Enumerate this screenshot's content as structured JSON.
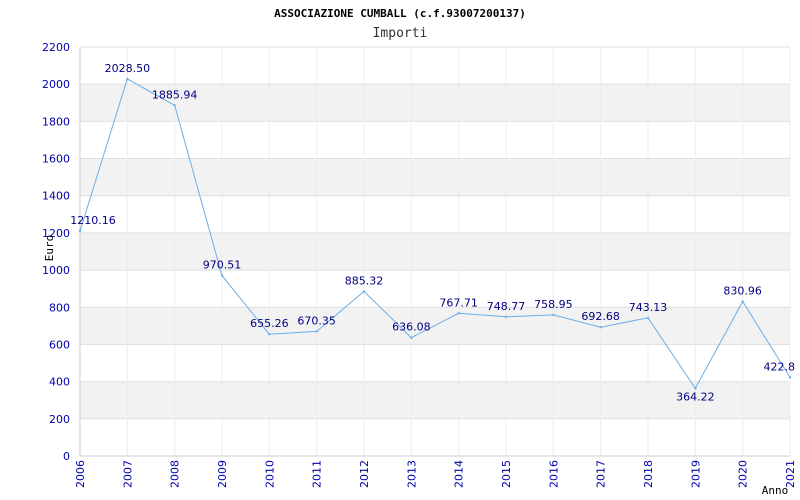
{
  "chart_data": {
    "type": "line",
    "title": "ASSOCIAZIONE CUMBALL (c.f.93007200137)",
    "subtitle": "Importi",
    "ylabel": "Euro",
    "xlabel": "Anno",
    "ylim": [
      0,
      2200
    ],
    "y_ticks": [
      0,
      200,
      400,
      600,
      800,
      1000,
      1200,
      1400,
      1600,
      1800,
      2000,
      2200
    ],
    "x": [
      "2006",
      "2007",
      "2008",
      "2009",
      "2010",
      "2011",
      "2012",
      "2013",
      "2014",
      "2015",
      "2016",
      "2017",
      "2018",
      "2019",
      "2020",
      "2021"
    ],
    "values": [
      1210.16,
      2028.5,
      1885.94,
      970.51,
      655.26,
      670.35,
      885.32,
      636.08,
      767.71,
      748.77,
      758.95,
      692.68,
      743.13,
      364.22,
      830.96,
      422.8
    ],
    "value_labels": [
      "1210.16",
      "2028.50",
      "1885.94",
      "970.51",
      "655.26",
      "670.35",
      "885.32",
      "636.08",
      "767.71",
      "748.77",
      "758.95",
      "692.68",
      "743.13",
      "364.22",
      "830.96",
      "422.8"
    ],
    "grid": true,
    "colors": {
      "line": "#6aaeea",
      "band": "#f2f2f2",
      "tick": "#0000aa",
      "label": "#000080"
    }
  }
}
